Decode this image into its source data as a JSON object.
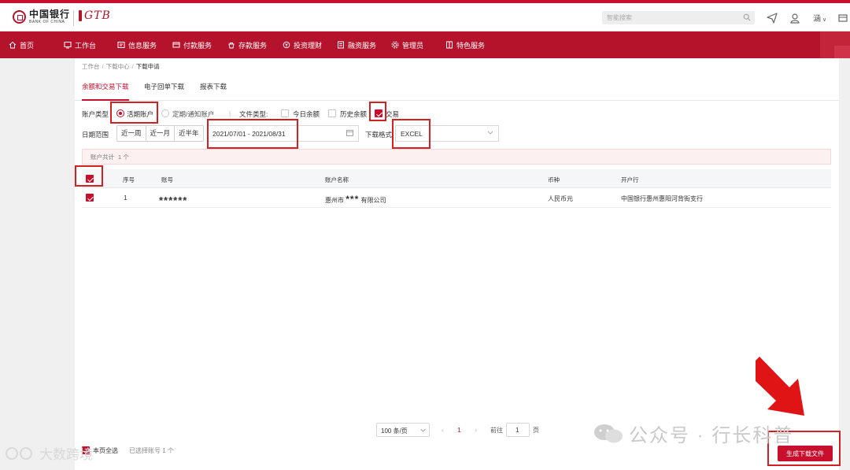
{
  "header": {
    "bank_name_cn": "中国银行",
    "bank_name_en": "BANK OF CHINA",
    "gtb_logo": "GTB",
    "search_placeholder": "智能搜索",
    "user_name": "涵",
    "icons": [
      "search-icon",
      "send-icon",
      "user-badge-icon",
      "expand-icon"
    ]
  },
  "nav": {
    "items": [
      {
        "label": "首页",
        "icon": "home-icon"
      },
      {
        "label": "工作台",
        "icon": "workbench-icon"
      },
      {
        "label": "信息服务",
        "icon": "info-icon"
      },
      {
        "label": "付款服务",
        "icon": "payment-icon"
      },
      {
        "label": "存款服务",
        "icon": "deposit-icon"
      },
      {
        "label": "投资理财",
        "icon": "invest-icon"
      },
      {
        "label": "融资服务",
        "icon": "finance-icon"
      },
      {
        "label": "管理员",
        "icon": "admin-icon"
      },
      {
        "label": "特色服务",
        "icon": "special-icon"
      }
    ],
    "accent_color": "#b5122b"
  },
  "breadcrumb": [
    "工作台",
    "下载中心",
    "下载申请"
  ],
  "tabs": [
    {
      "label": "余额和交易下载",
      "active": true
    },
    {
      "label": "电子回单下载",
      "active": false
    },
    {
      "label": "报表下载",
      "active": false
    }
  ],
  "filters": {
    "account_type_label": "账户类型",
    "account_type_options": [
      {
        "label": "活期账户",
        "selected": true
      },
      {
        "label": "定期/通知账户",
        "selected": false
      }
    ],
    "separator": "|",
    "file_type_label": "文件类型:",
    "file_type_options": [
      {
        "label": "今日余额",
        "checked": false
      },
      {
        "label": "历史余额",
        "checked": false
      },
      {
        "label": "交易",
        "checked": true
      }
    ],
    "date_range_label": "日期范围",
    "date_quick_buttons": [
      "近一周",
      "近一月",
      "近半年"
    ],
    "date_range_value": "2021/07/01 - 2021/08/31",
    "download_format_label": "下载格式",
    "download_format_value": "EXCEL"
  },
  "summary": {
    "label": "账户共计",
    "count": "1 个"
  },
  "table": {
    "columns": [
      "序号",
      "账号",
      "账户名称",
      "币种",
      "开户行"
    ],
    "rows": [
      {
        "selected": true,
        "index": "1",
        "account_no": "******",
        "account_name_prefix": "惠州市",
        "account_name_mask": "***",
        "account_name_suffix": "有限公司",
        "currency": "人民币元",
        "bank": "中国银行惠州惠阳河背街支行"
      }
    ]
  },
  "pagination": {
    "page_size": "100 条/页",
    "prev": "‹",
    "current_page": "1",
    "next": "›",
    "goto_label": "前往",
    "goto_value": "1",
    "page_suffix": "页"
  },
  "footer": {
    "select_all_label": "本页全选",
    "selected_count_label": "已选择账号 1 个",
    "generate_button": "生成下载文件"
  },
  "watermark": {
    "text": "公众号 · 行长科普",
    "text2": "大数跨境"
  },
  "colors": {
    "brand_red": "#c8102e",
    "highlight_box": "#d42020"
  }
}
